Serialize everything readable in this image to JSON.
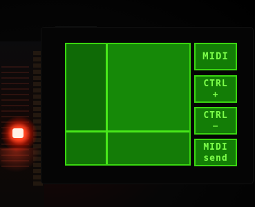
{
  "buttons": {
    "midi": {
      "label": "MIDI"
    },
    "ctrl_plus": {
      "line1": "CTRL",
      "line2": "+"
    },
    "ctrl_minus": {
      "line1": "CTRL",
      "line2": "−"
    },
    "midi_send": {
      "line1": "MIDI",
      "line2": "send"
    }
  },
  "xy_pad": {
    "crosshair_x": 0.33,
    "crosshair_y": 0.71
  },
  "colors": {
    "screen_bg": "#000000",
    "pad_fill": "#158207",
    "line_green": "#48e81a",
    "text_green": "#7dff4a",
    "led_red": "#ff3b1f"
  }
}
